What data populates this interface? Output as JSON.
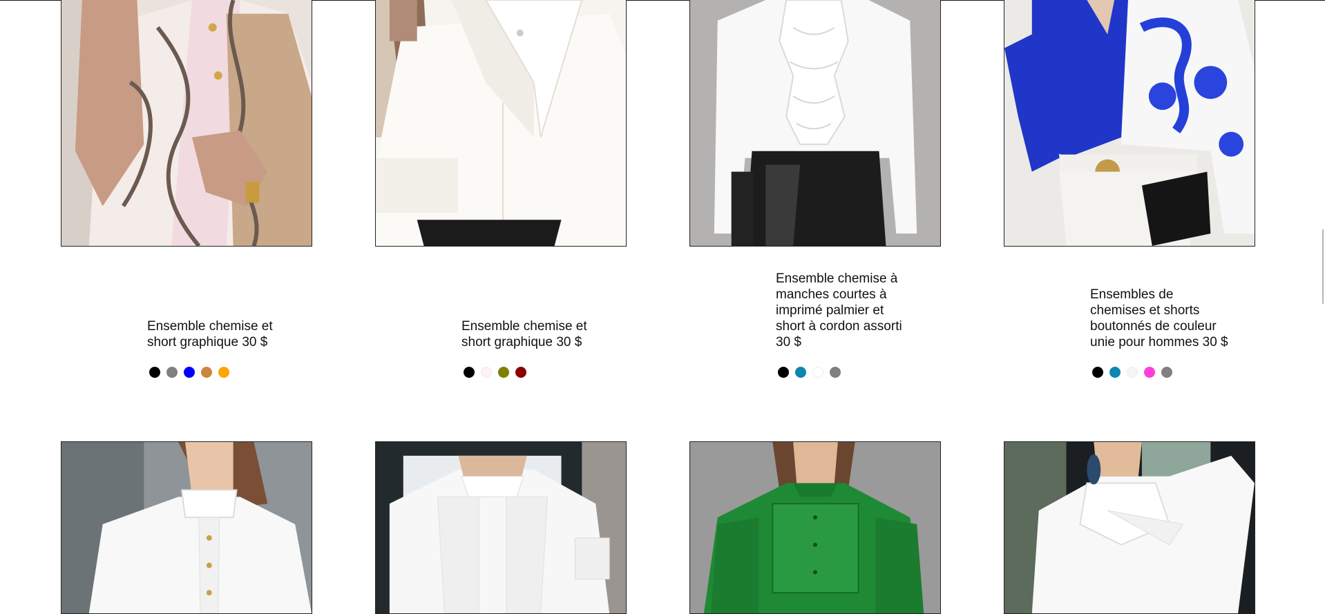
{
  "products": [
    {
      "title": "Ensemble chemise et short graphique 30 $",
      "image": "chain-print-blouse",
      "colors": [
        "#000000",
        "#808080",
        "#0000ff",
        "#cd853f",
        "#ffa500"
      ]
    },
    {
      "title": "Ensemble chemise et short graphique 30 $",
      "image": "white-asymmetric-collar-blouse",
      "colors": [
        "#000000",
        "#fff0f5",
        "#808000",
        "#8b0000"
      ]
    },
    {
      "title": "Ensemble chemise à manches courtes à imprimé palmier et short à cordon assorti 30 $",
      "image": "white-ruffle-blouse-leather-skirt",
      "colors": [
        "#000000",
        "#0e86b2",
        "#ffffff",
        "#808080"
      ]
    },
    {
      "title": "Ensembles de chemises et shorts boutonnés de couleur unie pour hommes 30 $",
      "image": "blue-white-floral-blouse",
      "colors": [
        "#000000",
        "#0e86b2",
        "#f5f5f5",
        "#ff3fd8",
        "#808080"
      ]
    },
    {
      "image": "white-ruffle-collar-blouse"
    },
    {
      "image": "white-lace-front-blouse"
    },
    {
      "image": "green-lace-blouse"
    },
    {
      "image": "white-bow-neck-blouse"
    }
  ]
}
